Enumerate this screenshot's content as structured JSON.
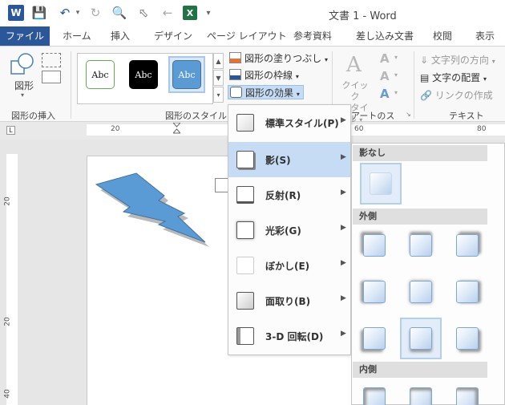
{
  "title_bar": {
    "word_logo": "W",
    "excel_logo": "X",
    "doc_title": "文書 1 - Word",
    "icons": [
      "word-app-icon",
      "save-icon",
      "undo-icon",
      "redo-icon",
      "print-preview-icon",
      "pointer-icon",
      "back-icon",
      "excel-icon",
      "customize-qat-icon"
    ]
  },
  "tabs": {
    "file": "ファイル",
    "home": "ホーム",
    "insert": "挿入",
    "design": "デザイン",
    "layout": "ページ レイアウト",
    "references": "参考資料",
    "mailings": "差し込み文書",
    "review": "校閲",
    "view": "表示"
  },
  "ribbon": {
    "insert_shapes": {
      "shapes_label": "図形",
      "group_label": "図形の挿入"
    },
    "shape_styles": {
      "gallery": [
        "Abc",
        "Abc",
        "Abc"
      ],
      "fill": "図形の塗りつぶし",
      "outline": "図形の枠線",
      "effects": "図形の効果",
      "group_label": "図形のスタイル"
    },
    "wordart": {
      "quick_style_line1": "クイック",
      "quick_style_line2": "スタイル",
      "group_label": "アートのス"
    },
    "text": {
      "text_direction": "文字列の方向",
      "text_align": "文字の配置",
      "create_link": "リンクの作成",
      "group_label": "テキスト"
    }
  },
  "ruler": {
    "corner": "L",
    "h_numbers": [
      "20",
      "60",
      "80"
    ],
    "v_numbers": [
      "20",
      "20",
      "40"
    ]
  },
  "effects_menu": {
    "items": [
      {
        "label": "標準スタイル(P)"
      },
      {
        "label": "影(S)",
        "active": true
      },
      {
        "label": "反射(R)"
      },
      {
        "label": "光彩(G)"
      },
      {
        "label": "ぼかし(E)"
      },
      {
        "label": "面取り(B)"
      },
      {
        "label": "3-D 回転(D)"
      }
    ]
  },
  "shadow_submenu": {
    "no_shadow": "影なし",
    "outer": "外側",
    "inner": "内側"
  },
  "colors": {
    "accent": "#2b579a",
    "shape_fill": "#5b9bd5",
    "menu_highlight": "#c5dcf4"
  }
}
